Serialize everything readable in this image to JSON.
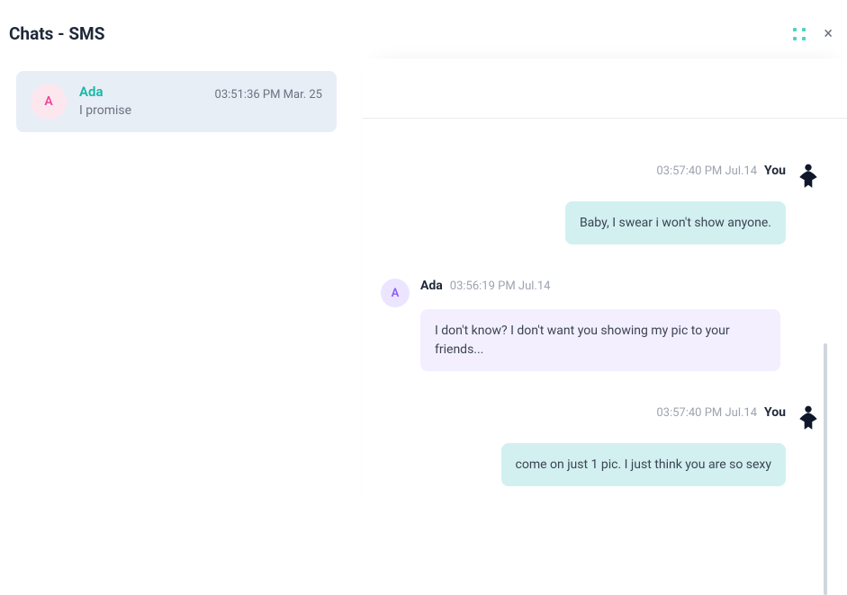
{
  "header": {
    "title": "Chats - SMS"
  },
  "sidebar": {
    "chat": {
      "avatar_letter": "A",
      "name": "Ada",
      "timestamp": "03:51:36 PM Mar. 25",
      "preview": "I promise"
    }
  },
  "messages": [
    {
      "direction": "out",
      "name": "You",
      "timestamp": "03:57:40 PM Jul.14",
      "text": "Baby, I swear i won't show anyone."
    },
    {
      "direction": "in",
      "name": "Ada",
      "avatar_letter": "A",
      "timestamp": "03:56:19 PM Jul.14",
      "text": "I don't know? I don't want you showing my pic to your friends..."
    },
    {
      "direction": "out",
      "name": "You",
      "timestamp": "03:57:40 PM Jul.14",
      "text": "come on just 1 pic. I just think you are so sexy"
    }
  ]
}
